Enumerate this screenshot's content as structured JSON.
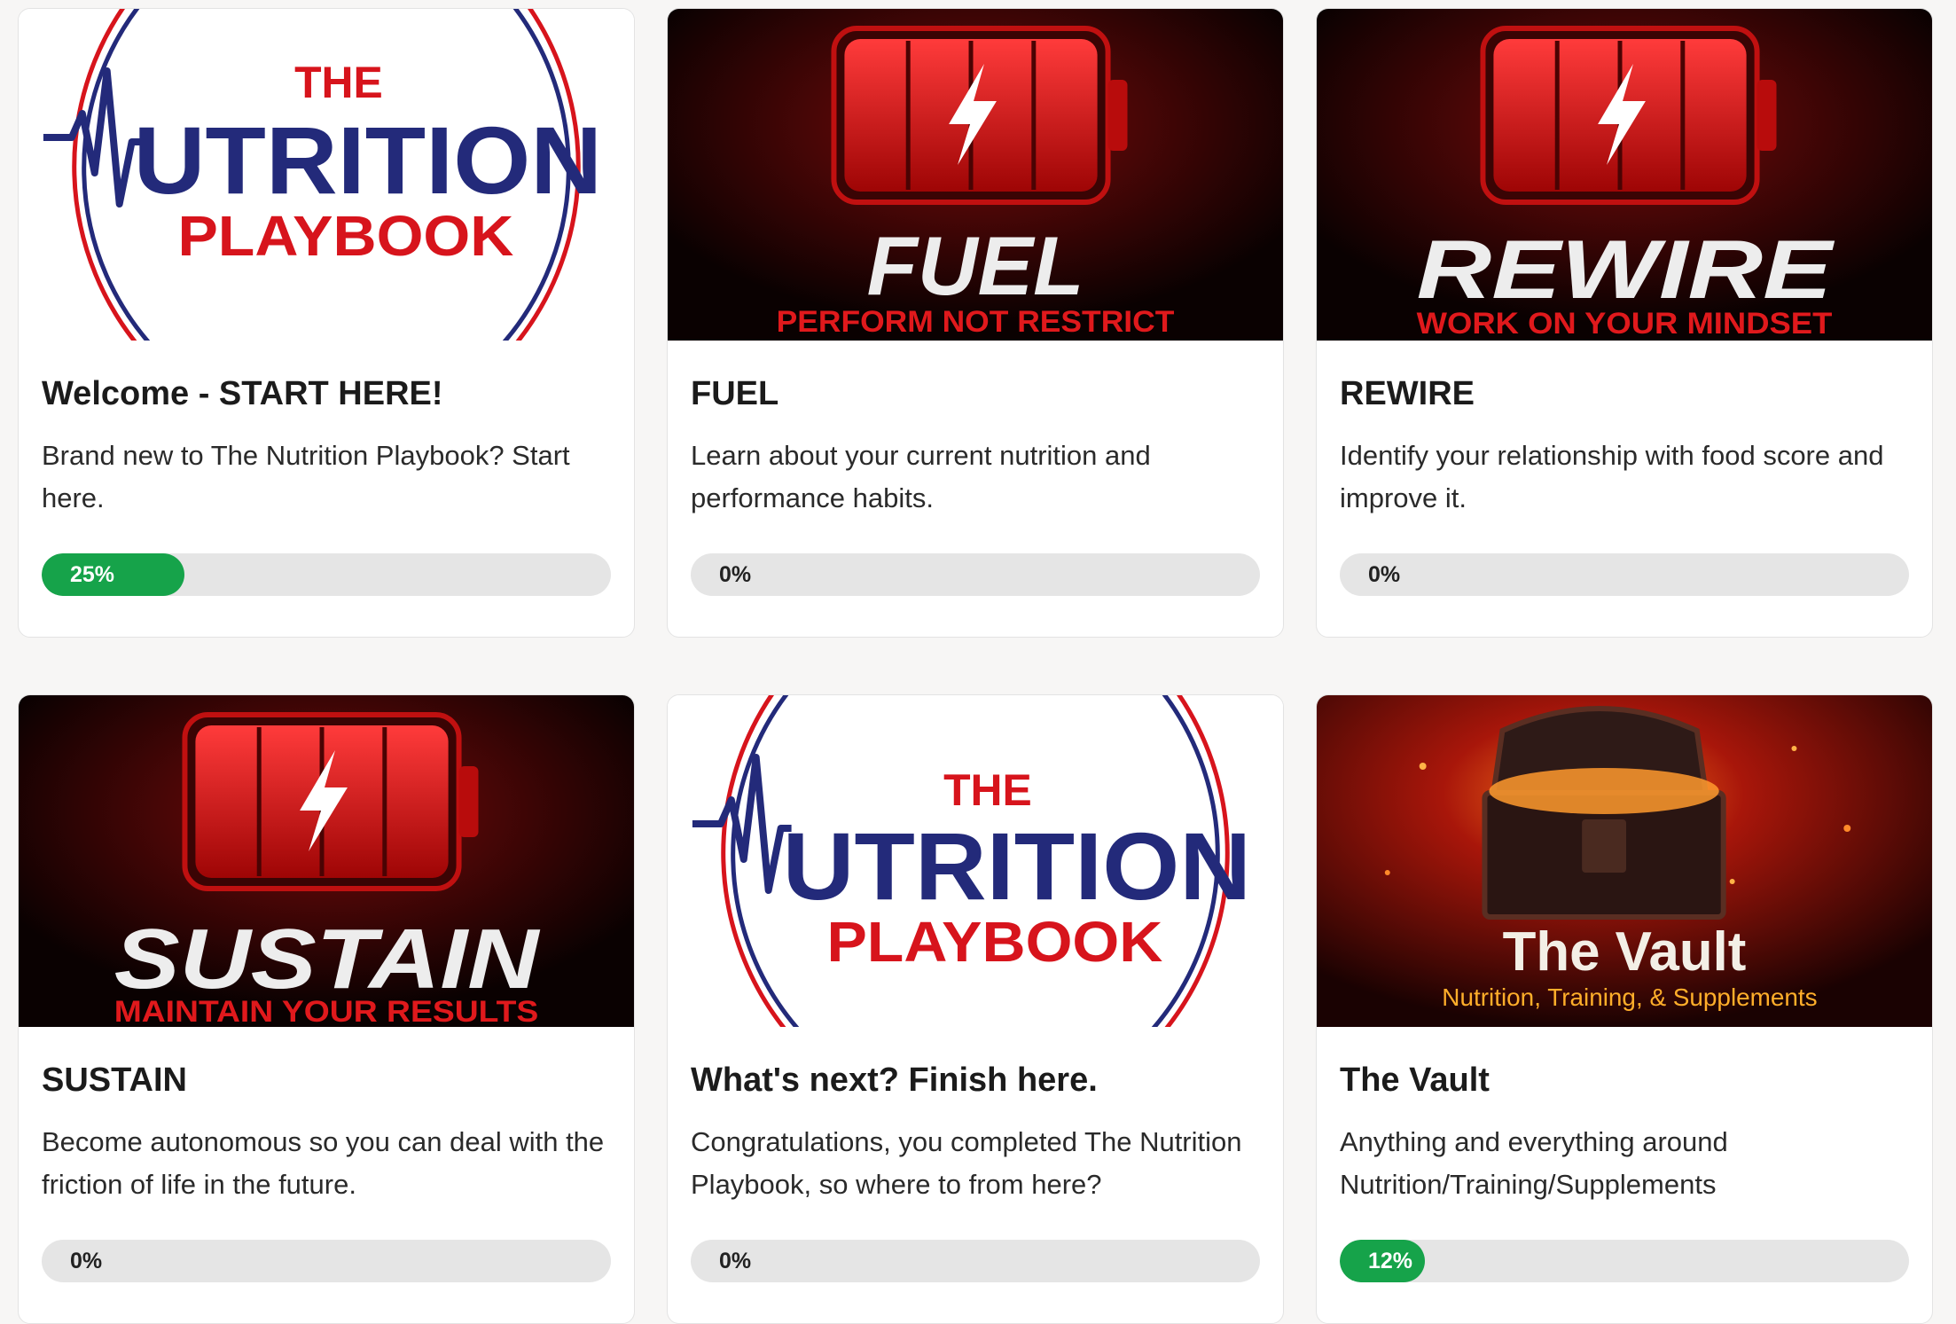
{
  "courses": [
    {
      "title": "Welcome - START HERE!",
      "description": "Brand new to The Nutrition Playbook? Start here.",
      "progress_label": "25%",
      "progress": 0.25,
      "image": {
        "type": "logo",
        "line1": "THE",
        "line2": "UTRITION",
        "line3": "PLAYBOOK"
      }
    },
    {
      "title": "FUEL",
      "description": "Learn about your current nutrition and performance habits.",
      "progress_label": "0%",
      "progress": 0,
      "image": {
        "type": "battery",
        "heading": "FUEL",
        "sub": "PERFORM NOT RESTRICT"
      }
    },
    {
      "title": "REWIRE",
      "description": "Identify your relationship with food score and improve it.",
      "progress_label": "0%",
      "progress": 0,
      "image": {
        "type": "battery",
        "heading": "REWIRE",
        "sub": "WORK ON YOUR MINDSET"
      }
    },
    {
      "title": "SUSTAIN",
      "description": "Become autonomous so you can deal with the friction of life in the future.",
      "progress_label": "0%",
      "progress": 0,
      "image": {
        "type": "battery",
        "heading": "SUSTAIN",
        "sub": "MAINTAIN YOUR RESULTS"
      }
    },
    {
      "title": "What's next? Finish here.",
      "description": "Congratulations, you completed The Nutrition Playbook, so where to from here?",
      "progress_label": "0%",
      "progress": 0,
      "image": {
        "type": "logo",
        "line1": "THE",
        "line2": "UTRITION",
        "line3": "PLAYBOOK"
      }
    },
    {
      "title": "The Vault",
      "description": "Anything and everything around Nutrition/Training/Supplements",
      "progress_label": "12%",
      "progress": 0.12,
      "image": {
        "type": "vault",
        "heading": "The Vault",
        "sub": "Nutrition, Training, & Supplements"
      }
    }
  ],
  "colors": {
    "progress_fill": "#16a34a",
    "track": "#e5e5e5",
    "brand_red": "#d7141c",
    "brand_navy": "#232a7a"
  }
}
